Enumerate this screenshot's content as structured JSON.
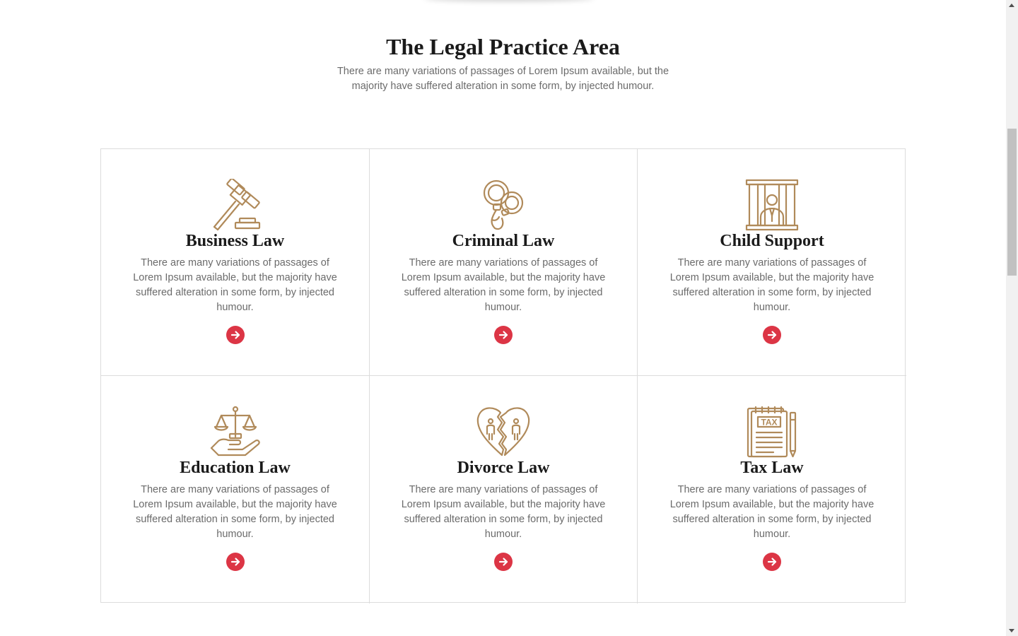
{
  "section": {
    "title": "The Legal Practice Area",
    "subtitle": "There are many variations of passages of Lorem Ipsum available, but the majority have suffered alteration in some form, by injected humour."
  },
  "colors": {
    "icon_accent": "#b08a5a",
    "button_accent": "#dc3545",
    "heading": "#1a1a1a",
    "body_text": "#6b6b6b",
    "border": "#dcdcdc"
  },
  "cards": [
    {
      "title": "Business Law",
      "icon": "gavel-icon",
      "text": "There are many variations of passages of Lorem Ipsum available, but the majority have suffered alteration in some form, by injected humour.",
      "button_icon": "arrow-right-icon"
    },
    {
      "title": "Criminal Law",
      "icon": "handcuffs-icon",
      "text": "There are many variations of passages of Lorem Ipsum available, but the majority have suffered alteration in some form, by injected humour.",
      "button_icon": "arrow-right-icon"
    },
    {
      "title": "Child Support",
      "icon": "jail-bars-icon",
      "text": "There are many variations of passages of Lorem Ipsum available, but the majority have suffered alteration in some form, by injected humour.",
      "button_icon": "arrow-right-icon"
    },
    {
      "title": "Education Law",
      "icon": "scales-on-hand-icon",
      "text": "There are many variations of passages of Lorem Ipsum available, but the majority have suffered alteration in some form, by injected humour.",
      "button_icon": "arrow-right-icon"
    },
    {
      "title": "Divorce Law",
      "icon": "broken-heart-couple-icon",
      "text": "There are many variations of passages of Lorem Ipsum available, but the majority have suffered alteration in some form, by injected humour.",
      "button_icon": "arrow-right-icon"
    },
    {
      "title": "Tax Law",
      "icon": "tax-document-icon",
      "icon_text": "TAX",
      "text": "There are many variations of passages of Lorem Ipsum available, but the majority have suffered alteration in some form, by injected humour.",
      "button_icon": "arrow-right-icon"
    }
  ]
}
